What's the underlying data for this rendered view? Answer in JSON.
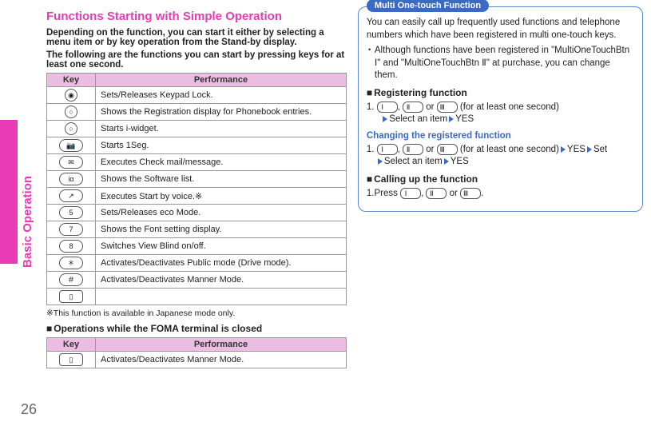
{
  "page_number": "26",
  "side_label": "Basic Operation",
  "left": {
    "title": "Functions Starting with Simple Operation",
    "intro1": "Depending on the function, you can start it either by selecting a menu item or by key operation from the Stand-by display.",
    "intro2": "The following are the functions you can start by pressing keys for at least one second.",
    "th_key": "Key",
    "th_perf": "Performance",
    "rows": [
      {
        "icon": "◉",
        "text": "Sets/Releases Keypad Lock."
      },
      {
        "icon": "○",
        "text": "Shows the Registration display for Phonebook entries."
      },
      {
        "icon": "○",
        "text": "Starts i-widget."
      },
      {
        "icon": "📷",
        "text": "Starts 1Seg."
      },
      {
        "icon": "✉",
        "text": "Executes Check mail/message."
      },
      {
        "icon": "iα",
        "text": "Shows the Software list."
      },
      {
        "icon": "↗",
        "text": "Executes Start by voice.※"
      },
      {
        "icon": "5",
        "text": "Sets/Releases eco Mode."
      },
      {
        "icon": "7",
        "text": "Shows the Font setting display."
      },
      {
        "icon": "8",
        "text": "Switches View Blind on/off."
      },
      {
        "icon": "＊",
        "text": "Activates/Deactivates Public mode (Drive mode)."
      },
      {
        "icon": "＃",
        "text": "Activates/Deactivates Manner Mode."
      },
      {
        "icon": "▯",
        "text": ""
      }
    ],
    "note": "※This function is available in Japanese mode only.",
    "closed_head": "Operations while the FOMA terminal is closed",
    "rows2": [
      {
        "icon": "▯",
        "text": "Activates/Deactivates Manner Mode."
      }
    ]
  },
  "right": {
    "callout_title": "Multi One-touch Function",
    "p1": "You can easily call up frequently used functions and telephone numbers which have been registered in multi one-touch keys.",
    "bullet1": "Although functions have been registered in \"MultiOneTouchBtn Ⅰ\" and  \"MultiOneTouchBtn Ⅱ\" at purchase, you can change them.",
    "reg_head": "Registering function",
    "key1": "Ⅰ",
    "key2": "Ⅱ",
    "key3": "Ⅲ",
    "reg_step": " (for at least one second)",
    "reg_step2a": "Select an item",
    "reg_step2b": "YES",
    "chg_head": "Changing the registered function",
    "chg_tail": " (for at least one second)",
    "chg_yes": "YES",
    "chg_set": "Set",
    "call_head": "Calling up the function",
    "call_prefix": "Press ",
    "call_or": " or ",
    "comma": ", ",
    "period": "."
  }
}
